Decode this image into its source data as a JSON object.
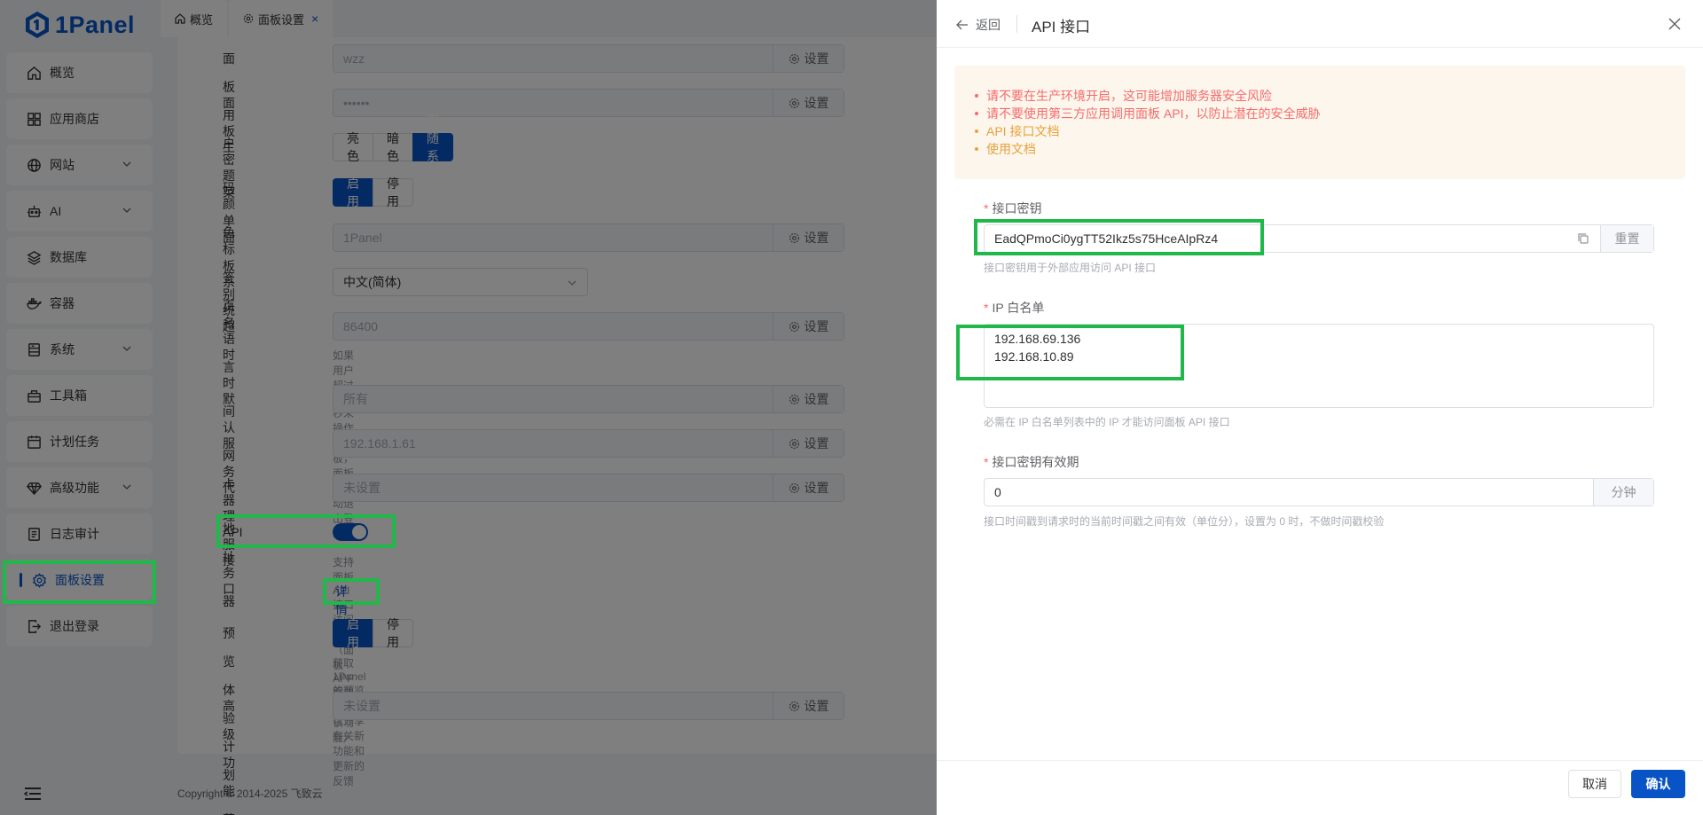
{
  "app": {
    "logo_text": "1Panel"
  },
  "sidebar": {
    "items": [
      {
        "label": "概览",
        "icon": "home-icon",
        "expandable": false
      },
      {
        "label": "应用商店",
        "icon": "apps-grid-icon",
        "expandable": false
      },
      {
        "label": "网站",
        "icon": "globe-icon",
        "expandable": true
      },
      {
        "label": "AI",
        "icon": "robot-icon",
        "expandable": true
      },
      {
        "label": "数据库",
        "icon": "layers-icon",
        "expandable": false
      },
      {
        "label": "容器",
        "icon": "docker-icon",
        "expandable": false
      },
      {
        "label": "系统",
        "icon": "server-icon",
        "expandable": true
      },
      {
        "label": "工具箱",
        "icon": "toolbox-icon",
        "expandable": false
      },
      {
        "label": "计划任务",
        "icon": "calendar-icon",
        "expandable": false
      },
      {
        "label": "高级功能",
        "icon": "diamond-icon",
        "expandable": true
      },
      {
        "label": "日志审计",
        "icon": "log-icon",
        "expandable": false
      },
      {
        "label": "面板设置",
        "icon": "gear-icon",
        "expandable": false,
        "active": true
      },
      {
        "label": "退出登录",
        "icon": "logout-icon",
        "expandable": false
      }
    ]
  },
  "tabs": [
    {
      "label": "概览",
      "icon": "home-icon"
    },
    {
      "label": "面板设置",
      "icon": "gear-icon",
      "closable": true
    }
  ],
  "settings": {
    "set_label": "设置",
    "panel_user": {
      "label": "面板用户",
      "value": "wzz"
    },
    "panel_password": {
      "label": "面板密码",
      "value": "••••••"
    },
    "theme": {
      "label": "主题颜色",
      "options": [
        "亮色",
        "暗色",
        "跟随系统"
      ],
      "selected": "跟随系统"
    },
    "menu_tabs": {
      "label": "菜单标签页",
      "options": [
        "启用",
        "停用"
      ],
      "selected": "启用"
    },
    "panel_alias": {
      "label": "面板别名",
      "value": "1Panel"
    },
    "language": {
      "label": "系统语言",
      "value": "中文(简体)"
    },
    "timeout": {
      "label": "超时时间",
      "value": "86400",
      "hint": "如果用户超过 86400 秒未操作面板，面板将自动退出登录"
    },
    "nic": {
      "label": "默认网卡",
      "value": "所有"
    },
    "server_addr": {
      "label": "服务器地址",
      "value": "192.168.1.61"
    },
    "proxy": {
      "label": "代理服务器",
      "value": "未设置"
    },
    "api": {
      "label": "API 接口",
      "enabled": true,
      "hint": "支持面板 API 接口访问功能（面板 APP 需要开启该功能）",
      "detail_link": "详情"
    },
    "preview": {
      "label": "预览体验计划",
      "options": [
        "启用",
        "停用"
      ],
      "selected": "启用",
      "hint": "获取 1Panel 的预览版本，以分享有关新功能和更新的反馈"
    },
    "hide_menu": {
      "label": "高级功能菜单隐藏",
      "value": "未设置"
    }
  },
  "footer": {
    "copyright": "Copyright © 2014-2025 飞致云"
  },
  "drawer": {
    "back_label": "返回",
    "title": "API 接口",
    "alerts": [
      {
        "text": "请不要在生产环境开启，这可能增加服务器安全风险",
        "color": "#f56c6c"
      },
      {
        "text": "请不要使用第三方应用调用面板 API，以防止潜在的安全威胁",
        "color": "#f56c6c"
      },
      {
        "text": "API 接口文档",
        "color": "#e6a23c",
        "link": true
      },
      {
        "text": "使用文档",
        "color": "#e6a23c",
        "link": true
      }
    ],
    "api_key": {
      "label": "接口密钥",
      "value": "EadQPmoCi0ygTT52Ikz5s75HceAIpRz4",
      "reset_label": "重置",
      "hint": "接口密钥用于外部应用访问 API 接口"
    },
    "ip_whitelist": {
      "label": "IP 白名单",
      "value": "192.168.69.136\n192.168.10.89",
      "hint": "必需在 IP 白名单列表中的 IP 才能访问面板 API 接口"
    },
    "key_validity": {
      "label": "接口密钥有效期",
      "value": "0",
      "unit": "分钟",
      "hint": "接口时间戳到请求时的当前时间戳之间有效（单位分），设置为 0 时，不做时间戳校验"
    },
    "cancel_label": "取消",
    "confirm_label": "确认"
  },
  "colors": {
    "primary": "#0854c7",
    "highlight_box": "#21b84a",
    "warning_bg": "#fdf6ec",
    "danger": "#f56c6c",
    "warning": "#e6a23c"
  }
}
